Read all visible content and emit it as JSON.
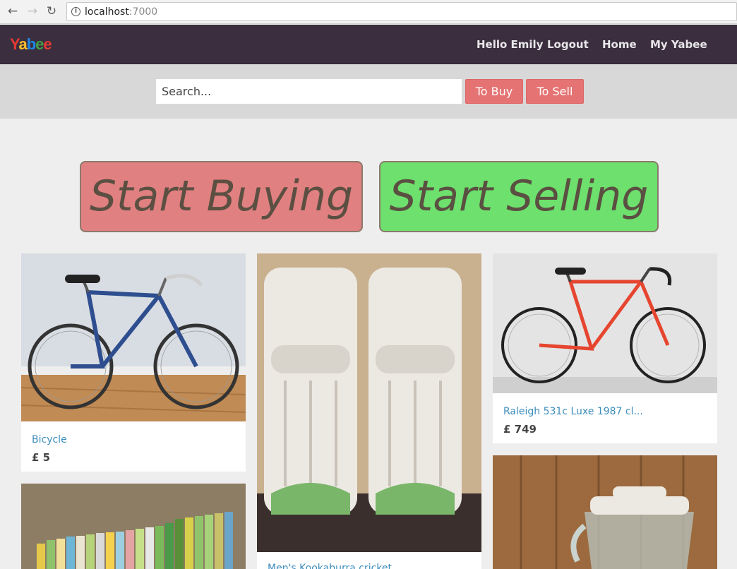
{
  "browser": {
    "url_host": "localhost",
    "url_port": ":7000"
  },
  "header": {
    "logo_text": "Yabee",
    "logo_colors": [
      "#e53935",
      "#1e88e5",
      "#fbc02d",
      "#43a047",
      "#e53935"
    ],
    "greeting": "Hello Emily",
    "logout_label": "Logout",
    "home_label": "Home",
    "myyabee_label": "My Yabee"
  },
  "search": {
    "placeholder": "Search...",
    "to_buy_label": "To Buy",
    "to_sell_label": "To Sell"
  },
  "hero": {
    "buy_label": "Start Buying",
    "sell_label": "Start Selling"
  },
  "listings": [
    {
      "title": "Bicycle",
      "price": "£ 5",
      "image": "blue-road-bicycle"
    },
    {
      "title": "Men's Kookaburra cricket",
      "price": "",
      "image": "cricket-pads"
    },
    {
      "title": "Raleigh 531c Luxe 1987 cl...",
      "price": "£ 749",
      "image": "red-road-bicycle"
    },
    {
      "title": "",
      "price": "",
      "image": "bookshelf"
    },
    {
      "title": "",
      "price": "",
      "image": "blender"
    }
  ],
  "colors": {
    "header_bg": "#3b2f3f",
    "accent_red": "#e57373",
    "hero_buy": "#e08080",
    "hero_sell": "#6de06d",
    "link_blue": "#3c8dbc"
  }
}
